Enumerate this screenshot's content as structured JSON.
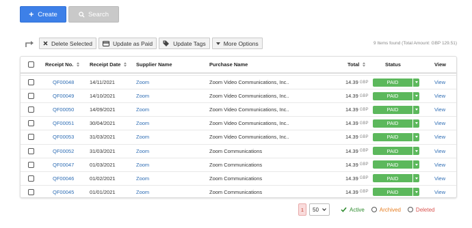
{
  "toolbar": {
    "create_label": "Create",
    "search_label": "Search"
  },
  "actions": {
    "delete_selected": "Delete Selected",
    "update_as_paid": "Update as Paid",
    "update_tags": "Update Tags",
    "more_options": "More Options"
  },
  "summary": "9 Items found (Total Amount: GBP 129.51)",
  "table": {
    "headers": {
      "receipt_no": "Receipt No.",
      "receipt_date": "Receipt Date",
      "supplier_name": "Supplier Name",
      "purchase_name": "Purchase Name",
      "total": "Total",
      "status": "Status",
      "view": "View"
    },
    "rows": [
      {
        "receipt_no": "QF00048",
        "date": "14/11/2021",
        "supplier": "Zoom",
        "purchase": "Zoom Video Communications, Inc..",
        "total": "14.39",
        "currency": "GBP",
        "status": "PAID",
        "view": "View"
      },
      {
        "receipt_no": "QF00049",
        "date": "14/10/2021",
        "supplier": "Zoom",
        "purchase": "Zoom Video Communications, Inc..",
        "total": "14.39",
        "currency": "GBP",
        "status": "PAID",
        "view": "View"
      },
      {
        "receipt_no": "QF00050",
        "date": "14/09/2021",
        "supplier": "Zoom",
        "purchase": "Zoom Video Communications, Inc..",
        "total": "14.39",
        "currency": "GBP",
        "status": "PAID",
        "view": "View"
      },
      {
        "receipt_no": "QF00051",
        "date": "30/04/2021",
        "supplier": "Zoom",
        "purchase": "Zoom Video Communications, Inc..",
        "total": "14.39",
        "currency": "GBP",
        "status": "PAID",
        "view": "View"
      },
      {
        "receipt_no": "QF00053",
        "date": "31/03/2021",
        "supplier": "Zoom",
        "purchase": "Zoom Video Communications, Inc..",
        "total": "14.39",
        "currency": "GBP",
        "status": "PAID",
        "view": "View"
      },
      {
        "receipt_no": "QF00052",
        "date": "31/03/2021",
        "supplier": "Zoom",
        "purchase": "Zoom Communications",
        "total": "14.39",
        "currency": "GBP",
        "status": "PAID",
        "view": "View"
      },
      {
        "receipt_no": "QF00047",
        "date": "01/03/2021",
        "supplier": "Zoom",
        "purchase": "Zoom Communications",
        "total": "14.39",
        "currency": "GBP",
        "status": "PAID",
        "view": "View"
      },
      {
        "receipt_no": "QF00046",
        "date": "01/02/2021",
        "supplier": "Zoom",
        "purchase": "Zoom Communications",
        "total": "14.39",
        "currency": "GBP",
        "status": "PAID",
        "view": "View"
      },
      {
        "receipt_no": "QF00045",
        "date": "01/01/2021",
        "supplier": "Zoom",
        "purchase": "Zoom Communications",
        "total": "14.39",
        "currency": "GBP",
        "status": "PAID",
        "view": "View"
      }
    ]
  },
  "pagination": {
    "current_page": "1",
    "per_page": "50"
  },
  "filters": {
    "active": "Active",
    "archived": "Archived",
    "deleted": "Deleted",
    "active_color": "#2e8b2e",
    "archived_color": "#e67e22",
    "deleted_color": "#d9534f"
  },
  "colors": {
    "primary": "#3d80e8",
    "paid": "#5cb85c",
    "link": "#2e6db4"
  }
}
